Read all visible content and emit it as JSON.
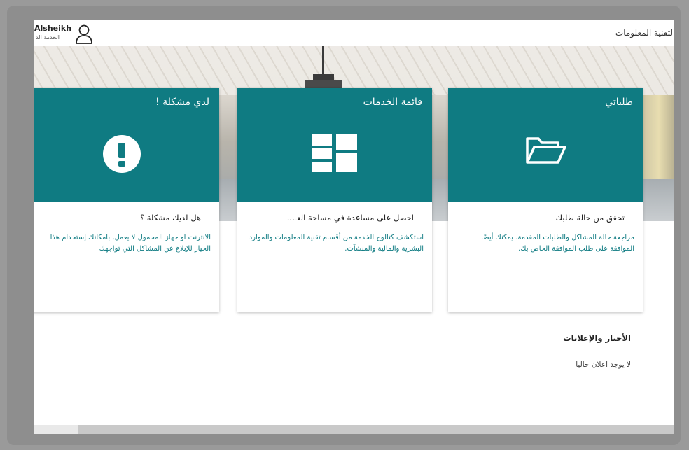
{
  "header": {
    "app_title": "لتقنية المعلومات",
    "user_name": "Alsheikh",
    "user_role": "الخدمة الذ"
  },
  "cards": [
    {
      "title": "طلباتي",
      "icon": "folder-open-icon",
      "subtitle": "تحقق من حالة طلبك",
      "description": "مراجعة حالة المشاكل والطلبات المقدمة. يمكنك أيضًا الموافقة على طلب الموافقة الخاص بك."
    },
    {
      "title": "قائمة الخدمات",
      "icon": "grid-icon",
      "subtitle": "احصل على مساعدة في مساحة العـ...",
      "description": "استكشف كتالوج الخدمة من أقسام تقنية المعلومات والموارد البشرية والمالية والمنشآت."
    },
    {
      "title": "لدي مشكلة !",
      "icon": "exclamation-icon",
      "subtitle": "هل لديك مشكلة ؟",
      "description": "الانترنت او جهاز المحمول لا يعمل, بامكانك إستخدام هذا الخيار للإبلاغ عن المشاكل التي تواجهك"
    }
  ],
  "news": {
    "title": "الأخبار والإعلانات",
    "empty_text": "لا يوجد اعلان حاليا"
  },
  "colors": {
    "accent": "#0f7b82",
    "link": "#0f7b82"
  }
}
